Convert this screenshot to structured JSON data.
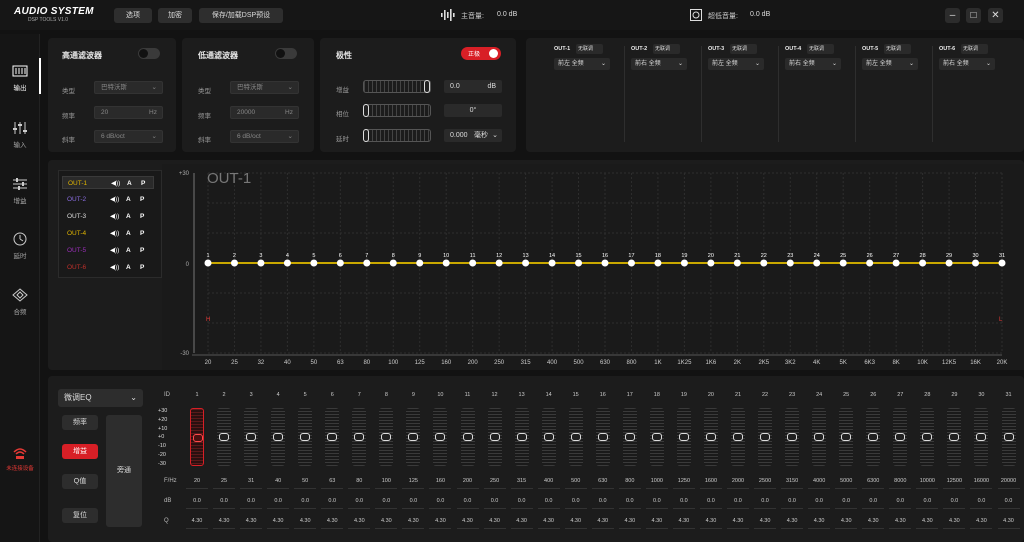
{
  "app": {
    "title": "AUDIO SYSTEM",
    "subtitle": "DSP TOOLS  V1.0"
  },
  "toolbar": {
    "btn1": "选项",
    "btn2": "加密",
    "btn3": "保存/加载DSP预设"
  },
  "master": {
    "label": "主音量:",
    "value": "0.0 dB"
  },
  "bass": {
    "label": "超低音量:",
    "value": "0.0 dB"
  },
  "sidebar": [
    {
      "label": "输出",
      "icon": "output-icon"
    },
    {
      "label": "输入",
      "icon": "input-icon"
    },
    {
      "label": "增益",
      "icon": "gain-icon"
    },
    {
      "label": "延时",
      "icon": "delay-icon"
    },
    {
      "label": "合频",
      "icon": "crossover-icon"
    },
    {
      "label": "未连接设备",
      "icon": "device-icon"
    }
  ],
  "hpf": {
    "title": "高通滤波器",
    "type_label": "类型",
    "type_value": "巴特沃斯",
    "freq_label": "频率",
    "freq_value": "20",
    "freq_unit": "Hz",
    "slope_label": "斜率",
    "slope_value": "6 dB/oct"
  },
  "lpf": {
    "title": "低通滤波器",
    "type_label": "类型",
    "type_value": "巴特沃斯",
    "freq_label": "频率",
    "freq_value": "20000",
    "freq_unit": "Hz",
    "slope_label": "斜率",
    "slope_value": "6 dB/oct"
  },
  "polarity": {
    "title": "极性",
    "toggle_label": "正极",
    "gain_label": "增益",
    "gain_value": "0.0",
    "gain_unit": "dB",
    "phase_label": "相位",
    "phase_value": "0°",
    "delay_label": "延时",
    "delay_value": "0.000",
    "delay_unit": "毫秒"
  },
  "outputs": [
    {
      "name": "OUT-1",
      "link": "无联调",
      "pos": "前左 全频"
    },
    {
      "name": "OUT-2",
      "link": "无联调",
      "pos": "前右 全频"
    },
    {
      "name": "OUT-3",
      "link": "无联调",
      "pos": "前左 全频"
    },
    {
      "name": "OUT-4",
      "link": "无联调",
      "pos": "前右 全频"
    },
    {
      "name": "OUT-5",
      "link": "无联调",
      "pos": "前左 全频"
    },
    {
      "name": "OUT-6",
      "link": "无联调",
      "pos": "前右 全频"
    }
  ],
  "channels": [
    {
      "name": "OUT-1",
      "color": "#e0b400"
    },
    {
      "name": "OUT-2",
      "color": "#8a6de0"
    },
    {
      "name": "OUT-3",
      "color": "#dddddd"
    },
    {
      "name": "OUT-4",
      "color": "#e0b400"
    },
    {
      "name": "OUT-5",
      "color": "#9a2fb8"
    },
    {
      "name": "OUT-6",
      "color": "#c0302b"
    }
  ],
  "channel_icons": {
    "speaker": "◀))",
    "a": "A",
    "p": "P"
  },
  "graph": {
    "title": "OUT-1",
    "ymax": "+30",
    "yzero": "0",
    "ymin": "-30",
    "hmark": "H",
    "lmark": "L",
    "line_color": "#c9a800"
  },
  "chart_data": {
    "type": "line",
    "title": "OUT-1",
    "ylim": [
      -30,
      30
    ],
    "yticks": [
      "+30",
      "0",
      "-30"
    ],
    "categories": [
      "20",
      "25",
      "32",
      "40",
      "50",
      "63",
      "80",
      "100",
      "125",
      "160",
      "200",
      "250",
      "315",
      "400",
      "500",
      "630",
      "800",
      "1K",
      "1K25",
      "1K6",
      "2K",
      "2K5",
      "3K2",
      "4K",
      "5K",
      "6K3",
      "8K",
      "10K",
      "12K5",
      "16K",
      "20K"
    ],
    "points": [
      "1",
      "2",
      "3",
      "4",
      "5",
      "6",
      "7",
      "8",
      "9",
      "10",
      "11",
      "12",
      "13",
      "14",
      "15",
      "16",
      "17",
      "18",
      "19",
      "20",
      "21",
      "22",
      "23",
      "24",
      "25",
      "26",
      "27",
      "28",
      "29",
      "30",
      "31"
    ],
    "series": [
      {
        "values": [
          0,
          0,
          0,
          0,
          0,
          0,
          0,
          0,
          0,
          0,
          0,
          0,
          0,
          0,
          0,
          0,
          0,
          0,
          0,
          0,
          0,
          0,
          0,
          0,
          0,
          0,
          0,
          0,
          0,
          0,
          0
        ]
      }
    ],
    "grid": true
  },
  "eq": {
    "mode": "微调EQ",
    "btn_freq": "频率",
    "btn_gain": "增益",
    "btn_q": "Q值",
    "btn_reset": "复位",
    "btn_bypass": "旁通",
    "id_label": "ID",
    "freq_label": "F/Hz",
    "db_label": "dB",
    "q_label": "Q",
    "scale": [
      "+30",
      "+20",
      "+10",
      "+0",
      "-10",
      "-20",
      "-30"
    ],
    "ids": [
      "1",
      "2",
      "3",
      "4",
      "5",
      "6",
      "7",
      "8",
      "9",
      "10",
      "11",
      "12",
      "13",
      "14",
      "15",
      "16",
      "17",
      "18",
      "19",
      "20",
      "21",
      "22",
      "23",
      "24",
      "25",
      "26",
      "27",
      "28",
      "29",
      "30",
      "31"
    ],
    "freqs": [
      "20",
      "25",
      "31",
      "40",
      "50",
      "63",
      "80",
      "100",
      "125",
      "160",
      "200",
      "250",
      "315",
      "400",
      "500",
      "630",
      "800",
      "1000",
      "1250",
      "1600",
      "2000",
      "2500",
      "3150",
      "4000",
      "5000",
      "6300",
      "8000",
      "10000",
      "12500",
      "16000",
      "20000"
    ],
    "db": [
      "0.0",
      "0.0",
      "0.0",
      "0.0",
      "0.0",
      "0.0",
      "0.0",
      "0.0",
      "0.0",
      "0.0",
      "0.0",
      "0.0",
      "0.0",
      "0.0",
      "0.0",
      "0.0",
      "0.0",
      "0.0",
      "0.0",
      "0.0",
      "0.0",
      "0.0",
      "0.0",
      "0.0",
      "0.0",
      "0.0",
      "0.0",
      "0.0",
      "0.0",
      "0.0",
      "0.0"
    ],
    "q": [
      "4.30",
      "4.30",
      "4.30",
      "4.30",
      "4.30",
      "4.30",
      "4.30",
      "4.30",
      "4.30",
      "4.30",
      "4.30",
      "4.30",
      "4.30",
      "4.30",
      "4.30",
      "4.30",
      "4.30",
      "4.30",
      "4.30",
      "4.30",
      "4.30",
      "4.30",
      "4.30",
      "4.30",
      "4.30",
      "4.30",
      "4.30",
      "4.30",
      "4.30",
      "4.30",
      "4.30"
    ],
    "selected": "1"
  }
}
